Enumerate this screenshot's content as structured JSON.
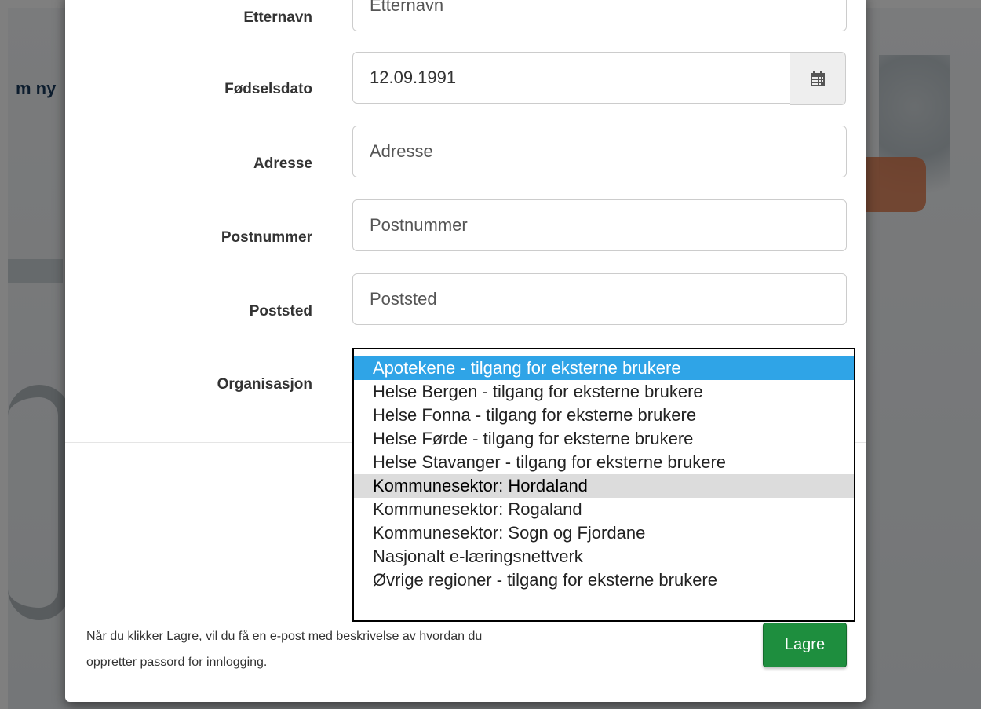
{
  "background": {
    "heading_fragment": "m ny"
  },
  "form": {
    "fields": {
      "etternavn": {
        "label": "Etternavn",
        "placeholder": "Etternavn"
      },
      "fodselsdato": {
        "label": "Fødselsdato",
        "value": "12.09.1991",
        "addon_icon": "calendar-icon"
      },
      "adresse": {
        "label": "Adresse",
        "placeholder": "Adresse"
      },
      "postnummer": {
        "label": "Postnummer",
        "placeholder": "Postnummer"
      },
      "poststed": {
        "label": "Poststed",
        "placeholder": "Poststed"
      },
      "organisasjon": {
        "label": "Organisasjon",
        "options": [
          "Apotekene - tilgang for eksterne brukere",
          "Helse Bergen - tilgang for eksterne brukere",
          "Helse Fonna - tilgang for eksterne brukere",
          "Helse Førde - tilgang for eksterne brukere",
          "Helse Stavanger - tilgang for eksterne brukere",
          "Kommunesektor: Hordaland",
          "Kommunesektor: Rogaland",
          "Kommunesektor: Sogn og Fjordane",
          "Nasjonalt e-læringsnettverk",
          "Øvrige regioner - tilgang for eksterne brukere"
        ],
        "selected_index": 0,
        "hover_index": 5
      }
    },
    "footer_note_line1": "Når du klikker Lagre, vil du få en e-post med beskrivelse av hvordan du",
    "footer_note_line2": "oppretter passord for innlogging.",
    "save_label": "Lagre"
  },
  "colors": {
    "selected_option": "#2fa4e7",
    "hover_option": "#dcdcdc",
    "save_button": "#1e8e3e"
  }
}
